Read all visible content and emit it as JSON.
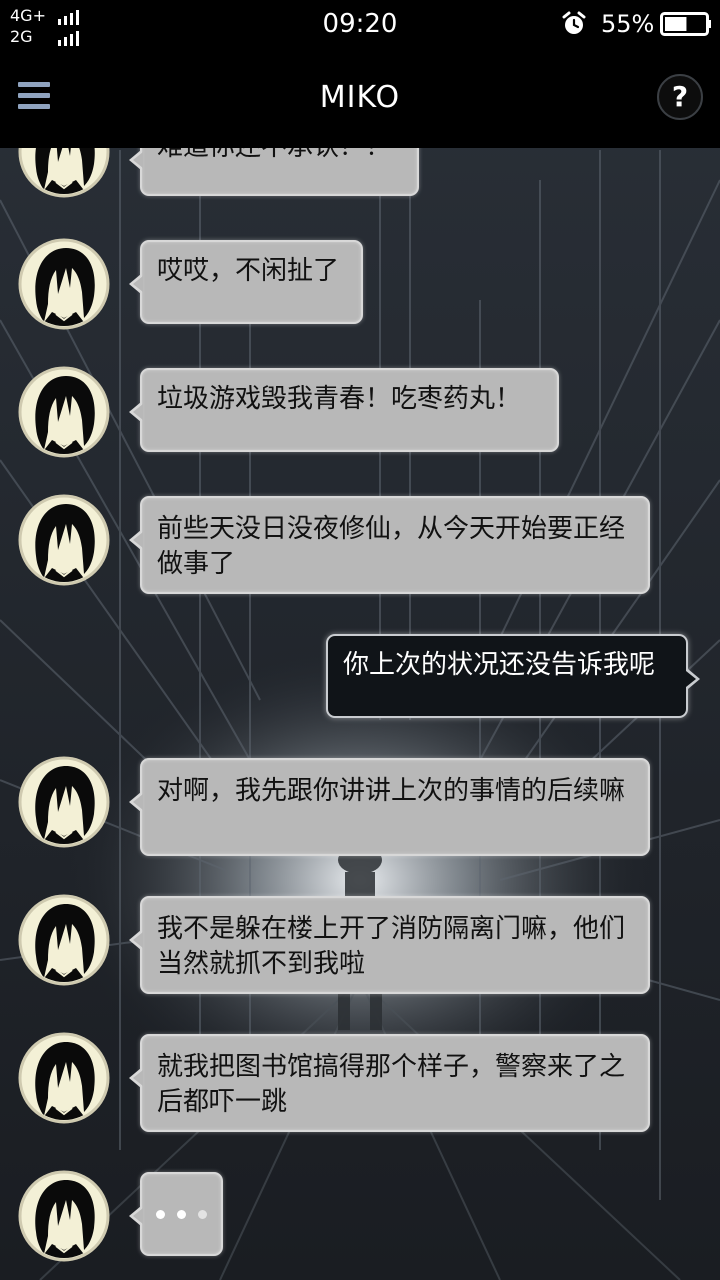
{
  "status_bar": {
    "network_1": "4G+",
    "network_2": "2G",
    "time": "09:20",
    "battery_percent": "55%",
    "alarm_icon": "alarm-clock-icon",
    "battery_level": 0.55
  },
  "app_bar": {
    "menu_icon": "hamburger-menu-icon",
    "title": "MIKO",
    "help_label": "?"
  },
  "chat": {
    "messages": [
      {
        "sender": "miko",
        "text": "难道你还不承认？！"
      },
      {
        "sender": "miko",
        "text": "哎哎，不闲扯了"
      },
      {
        "sender": "miko",
        "text": "垃圾游戏毁我青春！吃枣药丸！"
      },
      {
        "sender": "miko",
        "text": "前些天没日没夜修仙，从今天开始要正经做事了"
      },
      {
        "sender": "me",
        "text": "你上次的状况还没告诉我呢"
      },
      {
        "sender": "miko",
        "text": "对啊，我先跟你讲讲上次的事情的后续嘛"
      },
      {
        "sender": "miko",
        "text": "我不是躲在楼上开了消防隔离门嘛，他们当然就抓不到我啦"
      },
      {
        "sender": "miko",
        "text": "就我把图书馆搞得那个样子，警察来了之后都吓一跳"
      },
      {
        "sender": "miko",
        "typing": true
      }
    ]
  },
  "colors": {
    "incoming_bubble": "#b8b8b8",
    "outgoing_bubble": "#101418",
    "avatar_bg": "#f3f0d6",
    "menu_icon": "#8fa3bf"
  }
}
